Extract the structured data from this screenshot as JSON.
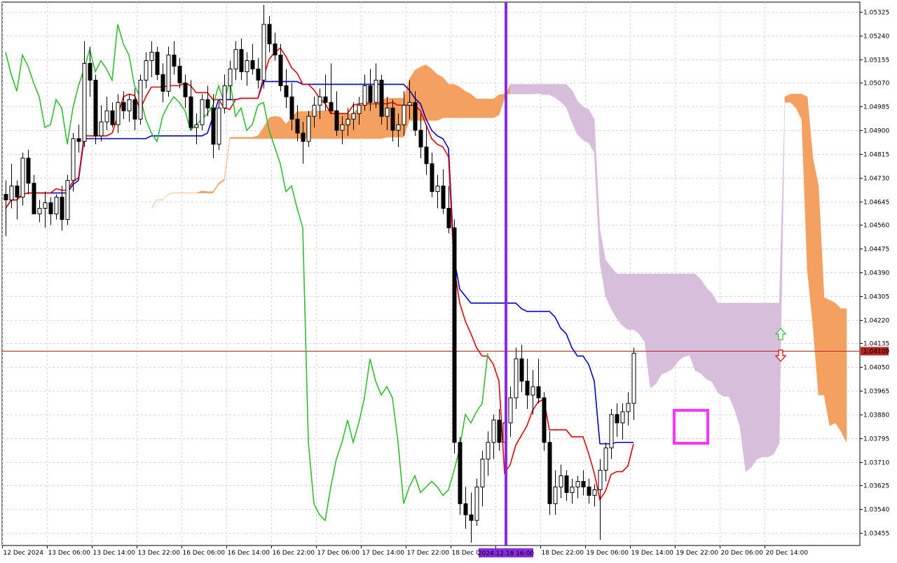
{
  "chart_data": {
    "type": "candlestick",
    "symbol": "EURUSD",
    "timeframe": "H1",
    "indicator": "Ichimoku Kinko Hyo",
    "ylim": [
      1.0341,
      1.0536
    ],
    "y_ticks": [
      "1.05325",
      "1.05240",
      "1.05155",
      "1.05070",
      "1.04985",
      "1.04900",
      "1.04815",
      "1.04730",
      "1.04645",
      "1.04560",
      "1.04475",
      "1.04390",
      "1.04305",
      "1.04220",
      "1.04135",
      "1.04050",
      "1.03965",
      "1.03880",
      "1.03795",
      "1.03710",
      "1.03625",
      "1.03540",
      "1.03455"
    ],
    "x_labels": [
      "12 Dec 2024",
      "13 Dec 06:00",
      "13 Dec 14:00",
      "13 Dec 22:00",
      "16 Dec 06:00",
      "16 Dec 14:00",
      "16 Dec 22:00",
      "17 Dec 06:00",
      "17 Dec 14:00",
      "17 Dec 22:00",
      "18 Dec 06:00",
      "",
      "18 Dec 22:00",
      "19 Dec 06:00",
      "19 Dec 14:00",
      "19 Dec 22:00",
      "20 Dec 06:00",
      "20 Dec 14:00"
    ],
    "current_price": "1.04109",
    "marker_label": "2024.12.18 16:00",
    "colors": {
      "tenkan": "#e00000",
      "kijun": "#0000cc",
      "chikou": "#33bb33",
      "kumo_bear": "#d7bfdc",
      "kumo_bull": "#f4a060",
      "vertical_marker": "#8a2be2",
      "highlight_box": "#ff33ff",
      "price_line": "#b22222",
      "price_label_bg": "#b22222",
      "up_arrow": "#33bb33",
      "down_arrow": "#e00000"
    },
    "candles": [
      [
        1.0467,
        1.0472,
        1.0452,
        1.0465
      ],
      [
        1.0465,
        1.0478,
        1.0462,
        1.047
      ],
      [
        1.047,
        1.0472,
        1.0458,
        1.0466
      ],
      [
        1.0466,
        1.0482,
        1.0463,
        1.048
      ],
      [
        1.048,
        1.0483,
        1.0467,
        1.0471
      ],
      [
        1.0471,
        1.0474,
        1.046,
        1.046
      ],
      [
        1.046,
        1.0465,
        1.0457,
        1.0462
      ],
      [
        1.0462,
        1.0468,
        1.0455,
        1.0464
      ],
      [
        1.0464,
        1.0466,
        1.0456,
        1.046
      ],
      [
        1.046,
        1.0467,
        1.0458,
        1.0466
      ],
      [
        1.0466,
        1.047,
        1.0454,
        1.0458
      ],
      [
        1.0458,
        1.0474,
        1.0456,
        1.0472
      ],
      [
        1.0472,
        1.0489,
        1.0468,
        1.0487
      ],
      [
        1.0487,
        1.0492,
        1.0482,
        1.0486
      ],
      [
        1.0486,
        1.0522,
        1.0484,
        1.0514
      ],
      [
        1.0514,
        1.052,
        1.0502,
        1.0508
      ],
      [
        1.0508,
        1.051,
        1.0485,
        1.0488
      ],
      [
        1.0488,
        1.0499,
        1.0486,
        1.0493
      ],
      [
        1.0493,
        1.0502,
        1.049,
        1.0497
      ],
      [
        1.0497,
        1.05,
        1.0491,
        1.0492
      ],
      [
        1.0492,
        1.0503,
        1.0489,
        1.05
      ],
      [
        1.05,
        1.0504,
        1.0494,
        1.0497
      ],
      [
        1.0497,
        1.0503,
        1.0493,
        1.0501
      ],
      [
        1.0501,
        1.0505,
        1.049,
        1.0494
      ],
      [
        1.0494,
        1.051,
        1.0492,
        1.0508
      ],
      [
        1.0508,
        1.0518,
        1.0505,
        1.0515
      ],
      [
        1.0515,
        1.0522,
        1.0509,
        1.0518
      ],
      [
        1.0518,
        1.052,
        1.0508,
        1.051
      ],
      [
        1.051,
        1.0514,
        1.05,
        1.0504
      ],
      [
        1.0504,
        1.052,
        1.0502,
        1.0517
      ],
      [
        1.0517,
        1.0522,
        1.051,
        1.0513
      ],
      [
        1.0513,
        1.0516,
        1.0505,
        1.0507
      ],
      [
        1.0507,
        1.051,
        1.0498,
        1.0502
      ],
      [
        1.0502,
        1.0508,
        1.049,
        1.0491
      ],
      [
        1.0491,
        1.0496,
        1.0485,
        1.0492
      ],
      [
        1.0492,
        1.0503,
        1.049,
        1.0501
      ],
      [
        1.0501,
        1.0506,
        1.0495,
        1.0498
      ],
      [
        1.0498,
        1.0503,
        1.048,
        1.0485
      ],
      [
        1.0485,
        1.05,
        1.0483,
        1.0498
      ],
      [
        1.0498,
        1.051,
        1.0496,
        1.0506
      ],
      [
        1.0506,
        1.0515,
        1.0501,
        1.0512
      ],
      [
        1.0512,
        1.0522,
        1.0508,
        1.0519
      ],
      [
        1.0519,
        1.0523,
        1.0508,
        1.0511
      ],
      [
        1.0511,
        1.0518,
        1.0506,
        1.0515
      ],
      [
        1.0515,
        1.0521,
        1.051,
        1.0512
      ],
      [
        1.0512,
        1.0516,
        1.0505,
        1.0508
      ],
      [
        1.0508,
        1.0535,
        1.0505,
        1.0528
      ],
      [
        1.0528,
        1.0531,
        1.0518,
        1.0521
      ],
      [
        1.0521,
        1.0525,
        1.0515,
        1.0517
      ],
      [
        1.0517,
        1.0521,
        1.0504,
        1.0506
      ],
      [
        1.0506,
        1.0512,
        1.0498,
        1.0502
      ],
      [
        1.0502,
        1.0507,
        1.049,
        1.0494
      ],
      [
        1.0494,
        1.0499,
        1.0486,
        1.0489
      ],
      [
        1.0489,
        1.0493,
        1.0478,
        1.0486
      ],
      [
        1.0486,
        1.0497,
        1.0484,
        1.0495
      ],
      [
        1.0495,
        1.0502,
        1.0491,
        1.0499
      ],
      [
        1.0499,
        1.0505,
        1.0494,
        1.0502
      ],
      [
        1.0502,
        1.051,
        1.0497,
        1.05
      ],
      [
        1.05,
        1.0514,
        1.0496,
        1.0497
      ],
      [
        1.0497,
        1.0504,
        1.0488,
        1.049
      ],
      [
        1.049,
        1.0495,
        1.0485,
        1.0492
      ],
      [
        1.0492,
        1.0498,
        1.0488,
        1.0494
      ],
      [
        1.0494,
        1.05,
        1.049,
        1.0496
      ],
      [
        1.0496,
        1.0502,
        1.0492,
        1.0499
      ],
      [
        1.0499,
        1.051,
        1.0497,
        1.0506
      ],
      [
        1.0506,
        1.0512,
        1.0497,
        1.05
      ],
      [
        1.05,
        1.0514,
        1.0498,
        1.0508
      ],
      [
        1.0508,
        1.051,
        1.0492,
        1.0495
      ],
      [
        1.0495,
        1.0502,
        1.049,
        1.0498
      ],
      [
        1.0498,
        1.0501,
        1.0486,
        1.049
      ],
      [
        1.049,
        1.0496,
        1.0484,
        1.0492
      ],
      [
        1.0492,
        1.0504,
        1.0488,
        1.0499
      ],
      [
        1.0499,
        1.0508,
        1.0494,
        1.05
      ],
      [
        1.05,
        1.0504,
        1.0488,
        1.049
      ],
      [
        1.049,
        1.0496,
        1.048,
        1.0484
      ],
      [
        1.0484,
        1.0492,
        1.0474,
        1.0478
      ],
      [
        1.0478,
        1.0482,
        1.0466,
        1.0468
      ],
      [
        1.0468,
        1.0474,
        1.0462,
        1.047
      ],
      [
        1.047,
        1.0476,
        1.046,
        1.0462
      ],
      [
        1.0462,
        1.047,
        1.0453,
        1.0455
      ],
      [
        1.0455,
        1.0458,
        1.0374,
        1.0378
      ],
      [
        1.0378,
        1.038,
        1.0352,
        1.0356
      ],
      [
        1.0356,
        1.0362,
        1.0347,
        1.0352
      ],
      [
        1.0352,
        1.036,
        1.0342,
        1.035
      ],
      [
        1.035,
        1.0365,
        1.0348,
        1.0362
      ],
      [
        1.0362,
        1.0375,
        1.0355,
        1.0372
      ],
      [
        1.0372,
        1.0382,
        1.0366,
        1.0378
      ],
      [
        1.0378,
        1.0388,
        1.0372,
        1.0386
      ],
      [
        1.0386,
        1.039,
        1.0375,
        1.0378
      ],
      [
        1.0378,
        1.0392,
        1.0374,
        1.0385
      ],
      [
        1.0385,
        1.0398,
        1.038,
        1.0394
      ],
      [
        1.0394,
        1.0412,
        1.039,
        1.0408
      ],
      [
        1.0408,
        1.0413,
        1.0396,
        1.04
      ],
      [
        1.04,
        1.0408,
        1.039,
        1.0395
      ],
      [
        1.0395,
        1.0404,
        1.0388,
        1.0398
      ],
      [
        1.0398,
        1.0408,
        1.0392,
        1.0394
      ],
      [
        1.0394,
        1.0396,
        1.0375,
        1.0378
      ],
      [
        1.0378,
        1.0382,
        1.0352,
        1.0356
      ],
      [
        1.0356,
        1.0368,
        1.0352,
        1.0362
      ],
      [
        1.0362,
        1.037,
        1.0358,
        1.0366
      ],
      [
        1.0366,
        1.0368,
        1.0357,
        1.036
      ],
      [
        1.036,
        1.0365,
        1.0356,
        1.0362
      ],
      [
        1.0362,
        1.0366,
        1.0358,
        1.0364
      ],
      [
        1.0364,
        1.0368,
        1.0359,
        1.0362
      ],
      [
        1.0362,
        1.0365,
        1.0356,
        1.0359
      ],
      [
        1.0359,
        1.0363,
        1.0355,
        1.0361
      ],
      [
        1.0361,
        1.0372,
        1.0343,
        1.0368
      ],
      [
        1.0368,
        1.0378,
        1.0364,
        1.0376
      ],
      [
        1.0376,
        1.039,
        1.0372,
        1.0388
      ],
      [
        1.0388,
        1.0392,
        1.038,
        1.0385
      ],
      [
        1.0385,
        1.0392,
        1.0379,
        1.0389
      ],
      [
        1.0389,
        1.0396,
        1.0384,
        1.0392
      ],
      [
        1.0392,
        1.0412,
        1.0386,
        1.041
      ]
    ],
    "kumo_ahead": [
      {
        "top": 1.0502,
        "bottom": 1.05
      },
      {
        "top": 1.0503,
        "bottom": 1.05
      },
      {
        "top": 1.0503,
        "bottom": 1.0498
      },
      {
        "top": 1.0503,
        "bottom": 1.0494
      },
      {
        "top": 1.0502,
        "bottom": 1.044
      },
      {
        "top": 1.048,
        "bottom": 1.042
      },
      {
        "top": 1.047,
        "bottom": 1.0395
      },
      {
        "top": 1.043,
        "bottom": 1.0395
      },
      {
        "top": 1.0429,
        "bottom": 1.0384
      },
      {
        "top": 1.0428,
        "bottom": 1.0385
      },
      {
        "top": 1.0426,
        "bottom": 1.0382
      },
      {
        "top": 1.0426,
        "bottom": 1.0378
      }
    ]
  }
}
